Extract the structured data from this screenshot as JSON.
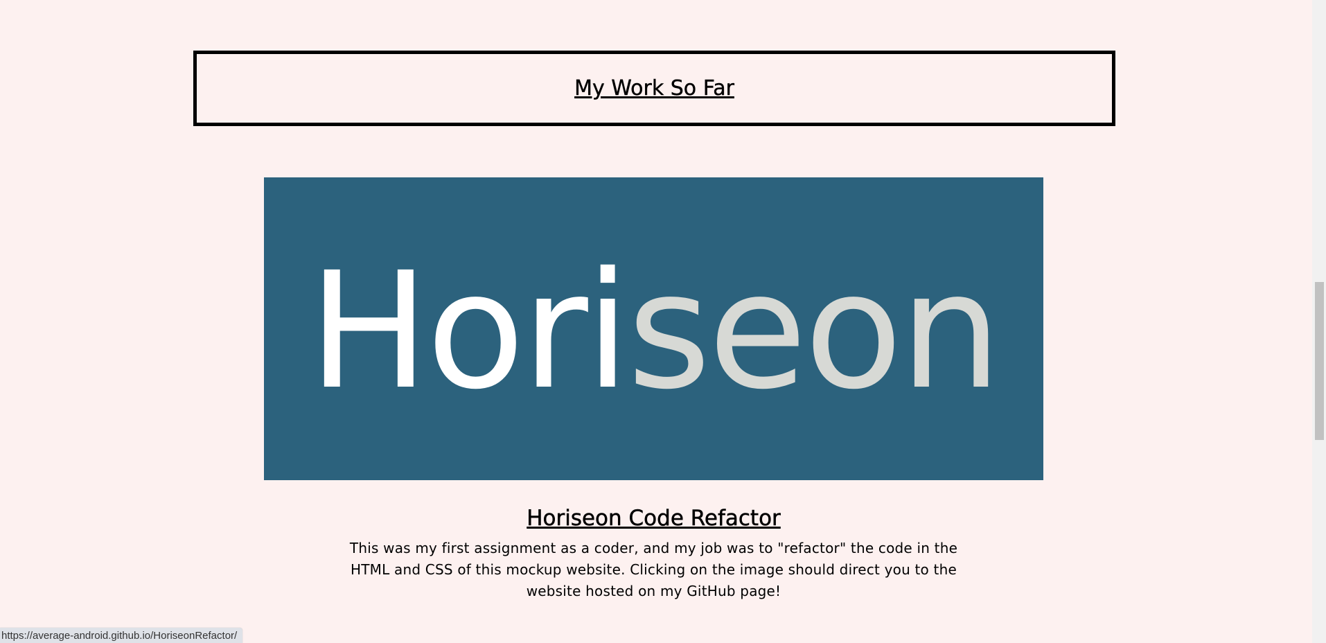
{
  "section": {
    "title": "My Work So Far"
  },
  "project": {
    "logo_part_a": "Hori",
    "logo_part_b": "seon",
    "title": "Horiseon Code Refactor",
    "description": "This was my first assignment as a coder, and my job was to \"refactor\" the code in the HTML and CSS of this mockup website. Clicking on the image should direct you to the website hosted on my GitHub page!",
    "link_url": "https://average-android.github.io/HoriseonRefactor/"
  },
  "status_bar": {
    "url": "https://average-android.github.io/HoriseonRefactor/"
  },
  "colors": {
    "page_background": "#fdf1f0",
    "logo_background": "#2c627d",
    "logo_white": "#ffffff",
    "logo_grey": "#d7d9d5"
  }
}
